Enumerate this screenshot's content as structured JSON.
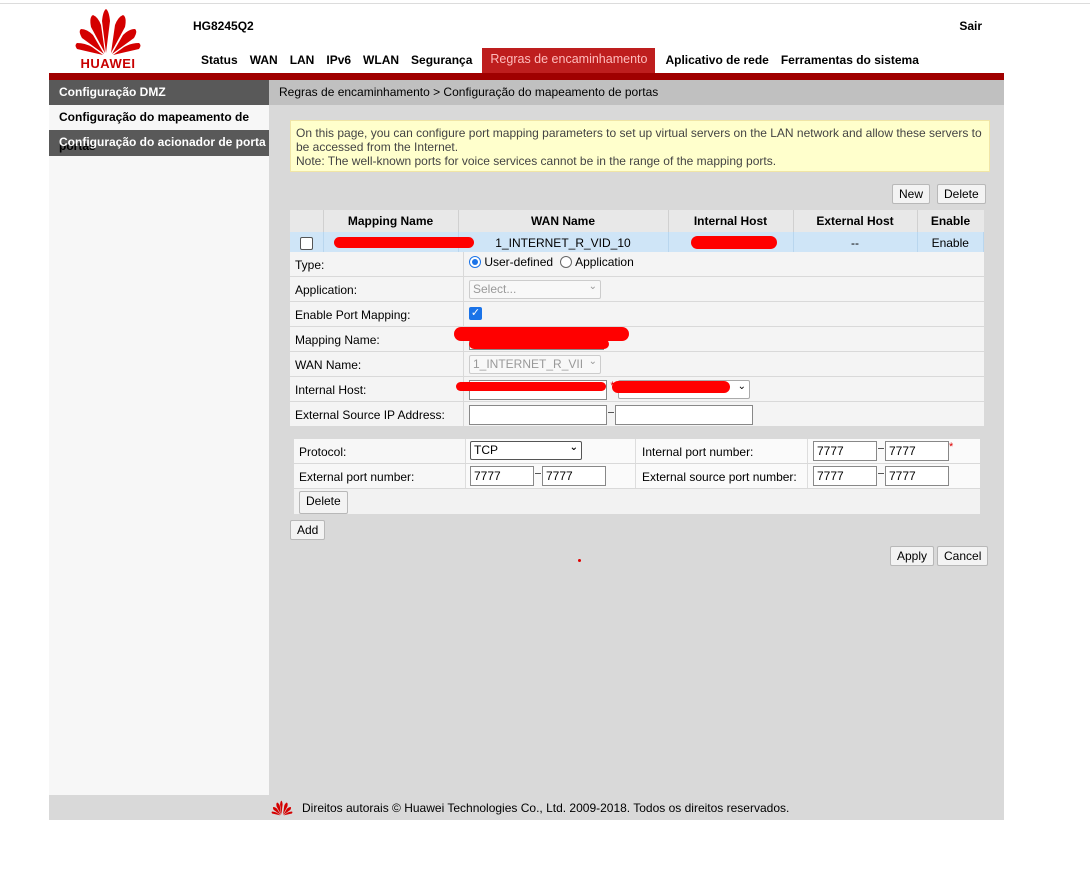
{
  "header": {
    "logo_text": "HUAWEI",
    "model": "HG8245Q2",
    "logout": "Sair",
    "nav": [
      "Status",
      "WAN",
      "LAN",
      "IPv6",
      "WLAN",
      "Segurança",
      "Regras de encaminhamento",
      "Aplicativo de rede",
      "Ferramentas do sistema"
    ],
    "active_nav": "Regras de encaminhamento"
  },
  "sidebar": {
    "items": [
      {
        "label": "Configuração DMZ",
        "state": "dark"
      },
      {
        "label": "Configuração do mapeamento de",
        "state": "selected"
      },
      {
        "label": "Configuração do acionador de porta",
        "state": "dark",
        "overlap_text": "portas"
      }
    ]
  },
  "breadcrumb": "Regras de encaminhamento  >  Configuração do mapeamento de portas",
  "note": {
    "line1": "On this page, you can configure port mapping parameters to set up virtual servers on the LAN network and allow these servers to be accessed from the Internet.",
    "line2": "Note: The well-known ports for voice services cannot be in the range of the mapping ports."
  },
  "buttons": {
    "new": "New",
    "delete": "Delete",
    "add": "Add",
    "apply": "Apply",
    "cancel": "Cancel",
    "row_delete": "Delete"
  },
  "table": {
    "headers": [
      "",
      "Mapping Name",
      "WAN Name",
      "Internal Host",
      "External Host",
      "Enable"
    ],
    "rows": [
      {
        "mapping_name": "",
        "wan_name": "1_INTERNET_R_VID_10",
        "internal_host": "",
        "external_host": "--",
        "enable": "Enable"
      }
    ]
  },
  "form": {
    "type_label": "Type:",
    "type_options": [
      "User-defined",
      "Application"
    ],
    "type_selected": "User-defined",
    "application_label": "Application:",
    "application_value": "Select...",
    "enable_label": "Enable Port Mapping:",
    "enable_checked": true,
    "mapping_name_label": "Mapping Name:",
    "wan_name_label": "WAN Name:",
    "wan_name_value": "1_INTERNET_R_VII",
    "internal_host_label": "Internal Host:",
    "ext_src_ip_label": "External Source IP Address:"
  },
  "ports": {
    "protocol_label": "Protocol:",
    "protocol_value": "TCP",
    "internal_port_label": "Internal port number:",
    "internal_port_start": "7777",
    "internal_port_end": "7777",
    "external_port_label": "External port number:",
    "external_port_start": "7777",
    "external_port_end": "7777",
    "ext_src_port_label": "External source port number:",
    "ext_src_port_start": "7777",
    "ext_src_port_end": "7777"
  },
  "footer": "Direitos autorais © Huawei Technologies Co., Ltd. 2009-2018. Todos os direitos reservados.",
  "colors": {
    "brand_red": "#c80000",
    "nav_active": "#be1e1e",
    "sidebar_dark": "#595959",
    "row_highlight": "#cfe5f7",
    "note_bg": "#ffffcc"
  }
}
